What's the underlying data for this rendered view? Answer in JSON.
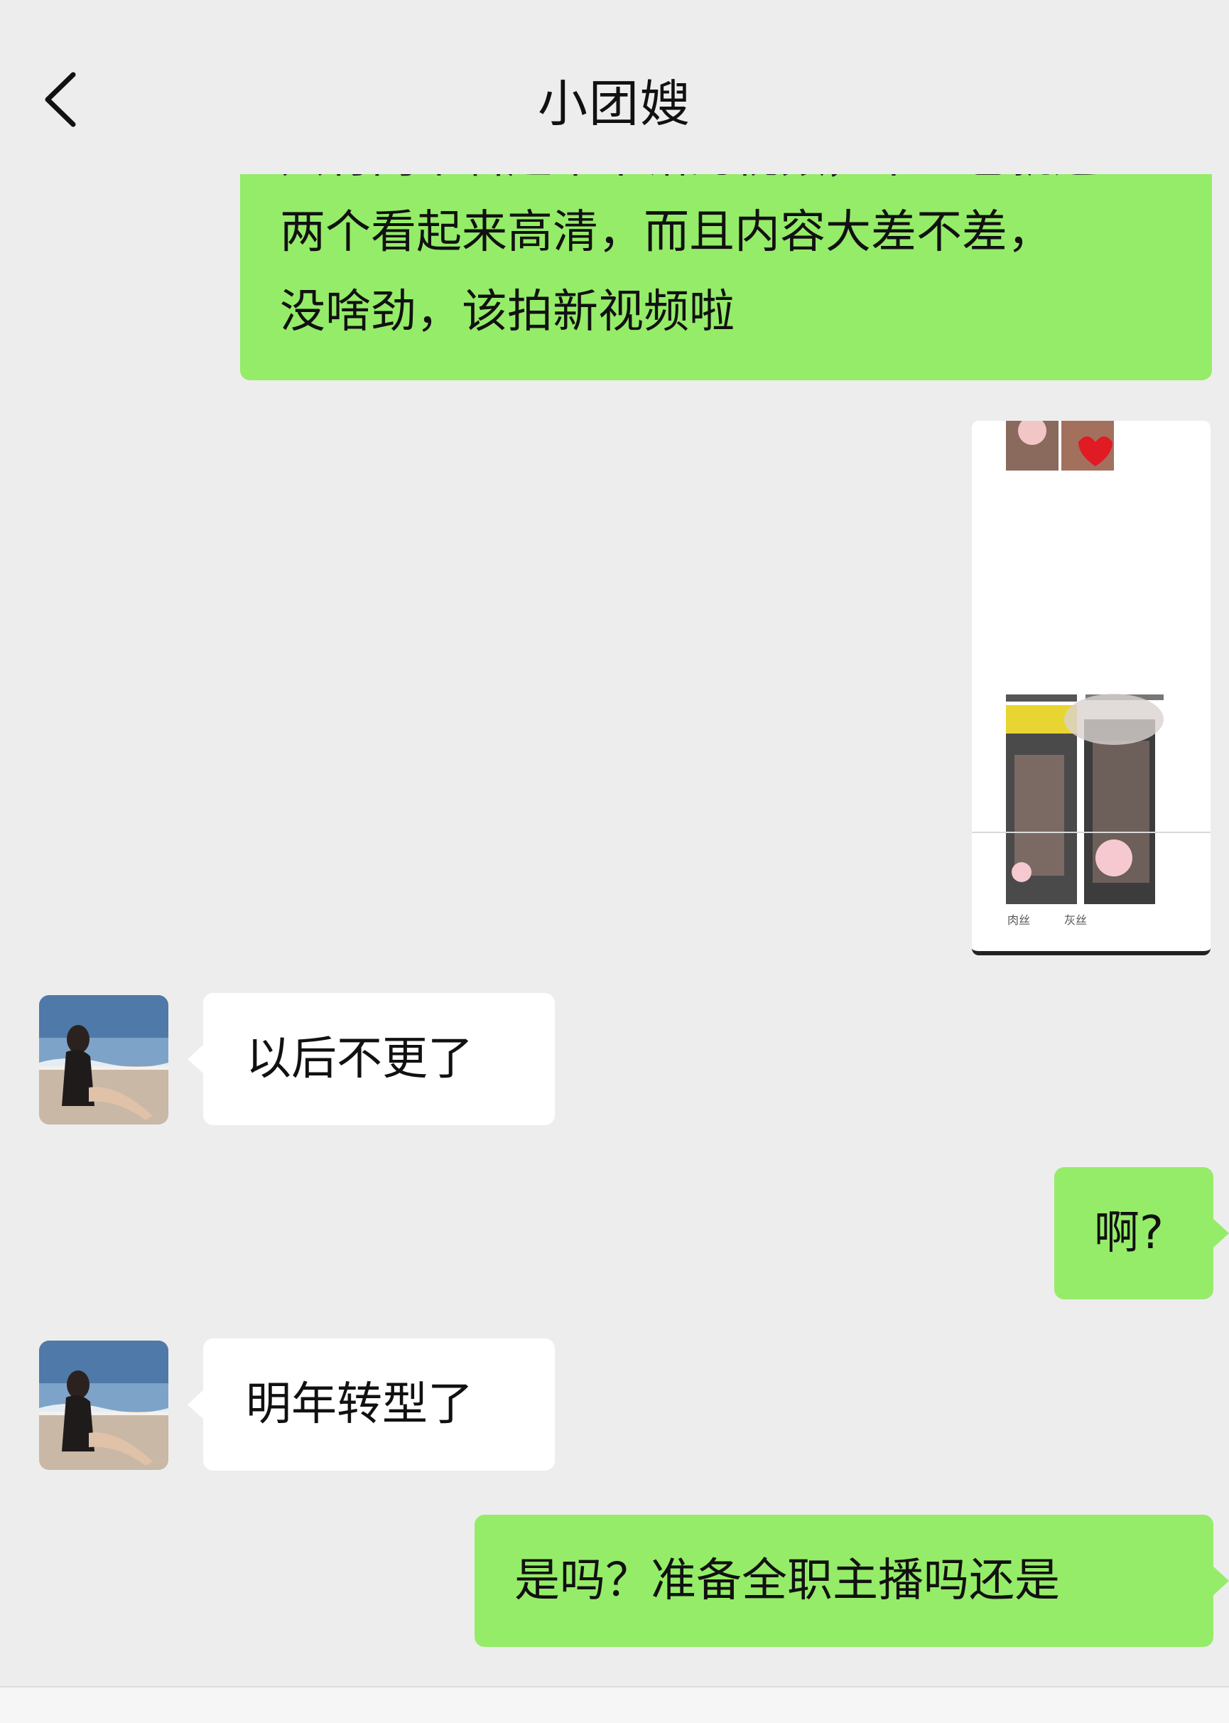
{
  "header": {
    "title": "小团嫂",
    "back_icon": "chevron-left-icon"
  },
  "colors": {
    "background": "#ededed",
    "outgoing_bubble": "#95ec69",
    "incoming_bubble": "#ffffff"
  },
  "messages": [
    {
      "direction": "outgoing",
      "type": "text",
      "partial_line": "只有两个看起来不错的视频，不过也就这",
      "lines": [
        "两个看起来高清，而且内容大差不差，",
        "没啥劲，该拍新视频啦"
      ]
    },
    {
      "direction": "outgoing",
      "type": "image",
      "caption_left": "肉丝",
      "caption_right": "灰丝"
    },
    {
      "direction": "incoming",
      "type": "text",
      "text": "以后不更了"
    },
    {
      "direction": "outgoing",
      "type": "text",
      "text": "啊?"
    },
    {
      "direction": "incoming",
      "type": "text",
      "text": "明年转型了"
    },
    {
      "direction": "outgoing",
      "type": "text",
      "text": "是吗？准备全职主播吗还是"
    }
  ]
}
